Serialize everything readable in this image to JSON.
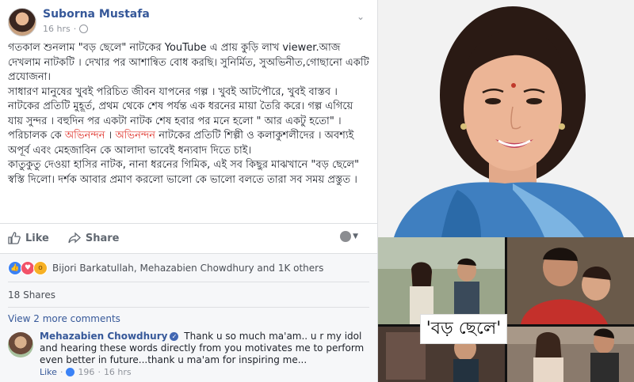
{
  "post": {
    "author": "Suborna Mustafa",
    "time": "16 hrs",
    "paragraphs": [
      [
        {
          "t": "গতকাল শুনলাম \"বড় ছেলে\" নাটকের YouTube এ প্রায় কুড়ি লাখ viewer.আজ দেখলাম নাটকটি । দেখার পর আশান্বিত বোধ করছি। সুনির্মিত, সুঅভিনীত,গোছানো একটি প্রযোজনা।"
        }
      ],
      [
        {
          "t": "সাধারণ মানুষের খুবই পরিচিত জীবন যাপনের গল্প । খুবই আটপৌরে, খুবই বাস্তব । নাটকের প্রতিটি মুহূর্ত, প্রথম থেকে শেষ পর্যন্ত এক ধরনের মায়া তৈরি করে। গল্প এগিয়ে যায় সুন্দর । বহুদিন পর একটা নাটক শেষ হবার পর মনে হলো \" আর একটু হতো\" ।"
        }
      ],
      [
        {
          "t": "পরিচালক কে "
        },
        {
          "t": "অভিনন্দন",
          "hl": true
        },
        {
          "t": " । "
        },
        {
          "t": "অভিনন্দন",
          "hl": true
        },
        {
          "t": " নাটকের প্রতিটি শিল্পী ও কলাকুশলীদের । অবশ্যই অপূর্ব এবং মেহজাবিন কে আলাদা ভাবেই ধন্যবাদ দিতে চাই।"
        }
      ],
      [
        {
          "t": "কাতুকুতু দেওয়া হাসির নাটক, নানা ধরনের গিমিক, এই সব কিছুর মাঝখানে \"বড় ছেলে\" স্বস্তি দিলো। দর্শক আবার প্রমাণ করলো ভালো কে ভালো বলতে তারা সব সময় প্রস্তুত ।"
        }
      ]
    ]
  },
  "actions": {
    "like": "Like",
    "share": "Share"
  },
  "reactions": {
    "names": "Bijori Barkatullah, Mehazabien Chowdhury and 1K others"
  },
  "shares": "18 Shares",
  "more_comments": "View 2 more comments",
  "comment": {
    "author": "Mehazabien Chowdhury",
    "text": "Thank u so much ma'am.. u r my idol and hearing these words directly from you motivates me to perform even better in future...thank u ma'am for inspiring me...",
    "like": "Like",
    "count": "196",
    "time": "16 hrs"
  },
  "title_card": "'বড় ছেলে'",
  "colors": {
    "link": "#365899",
    "highlight": "#e0342c",
    "saree": "#3f7fc0",
    "like_blue": "#3b82f6"
  }
}
